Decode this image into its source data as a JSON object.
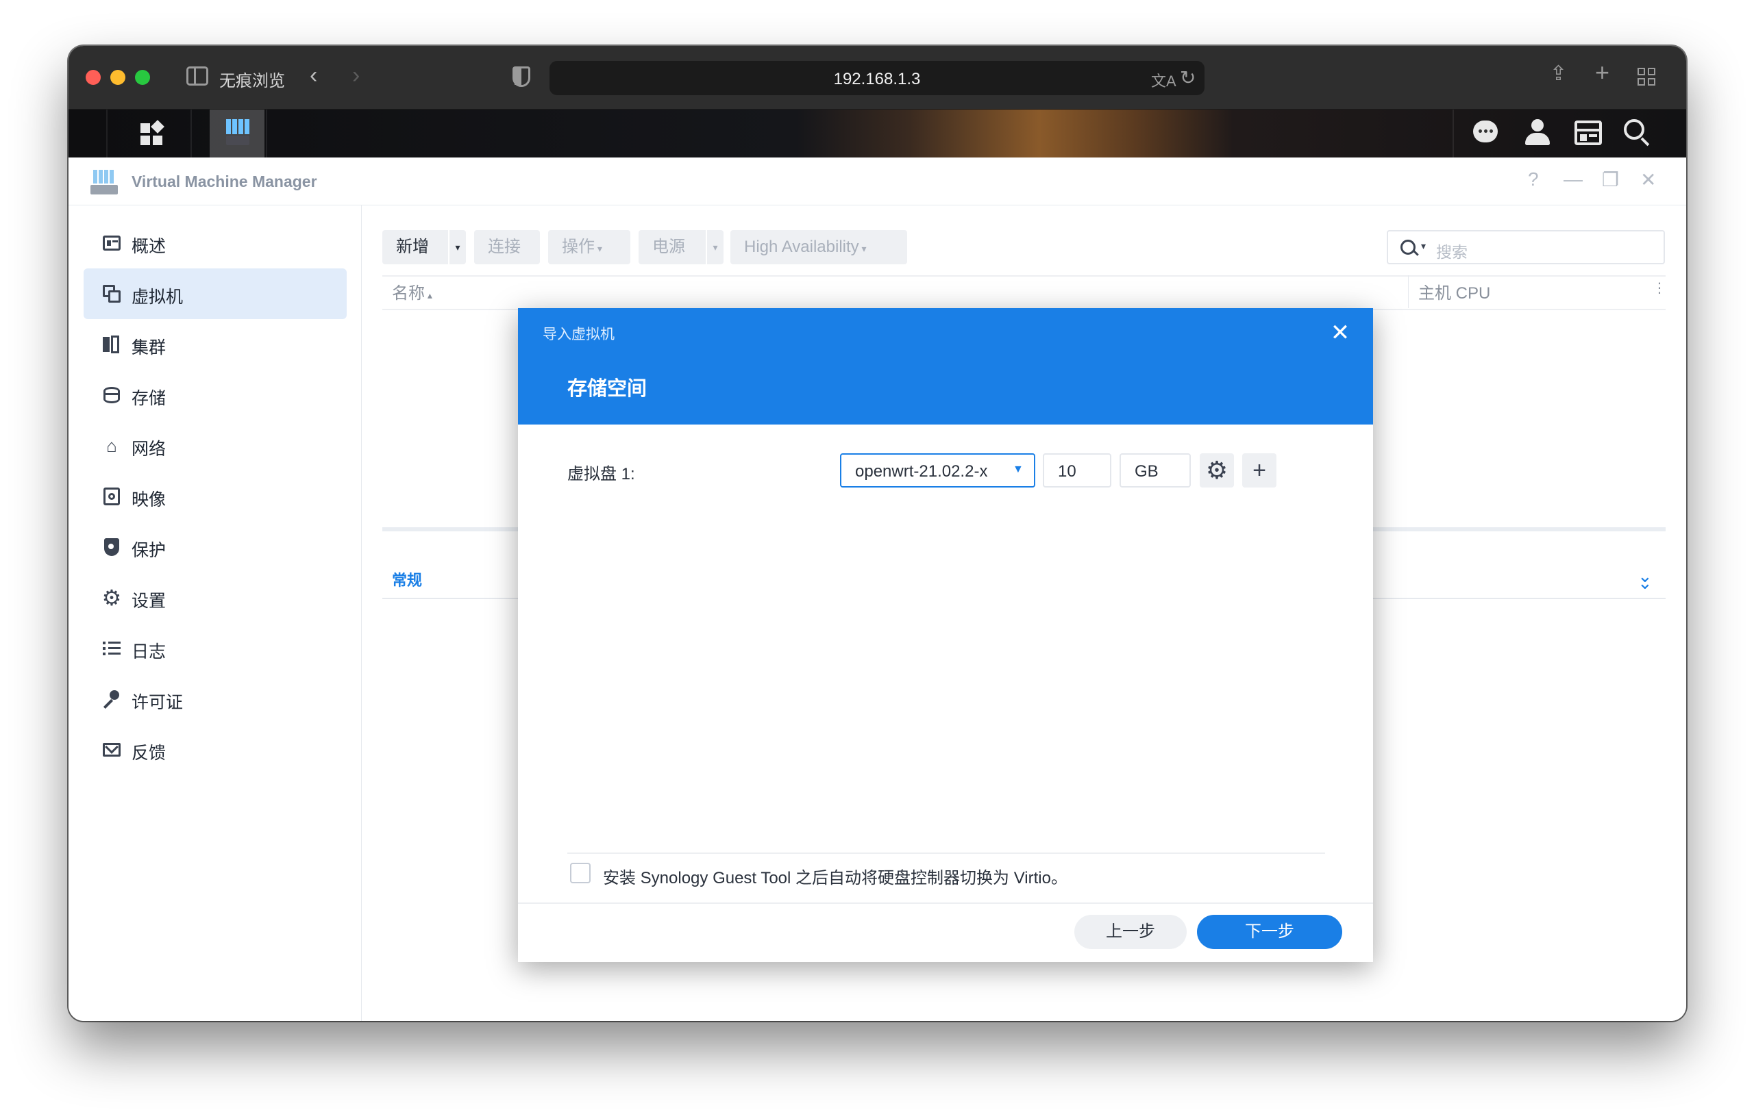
{
  "browser": {
    "tab_label": "无痕浏览",
    "url": "192.168.1.3"
  },
  "app": {
    "title": "Virtual Machine Manager",
    "header_controls": [
      "?",
      "—",
      "❐",
      "✕"
    ]
  },
  "sidebar": {
    "items": [
      {
        "label": "概述",
        "icon": "overview-icon"
      },
      {
        "label": "虚拟机",
        "icon": "virtual-machine-icon",
        "active": true
      },
      {
        "label": "集群",
        "icon": "cluster-icon"
      },
      {
        "label": "存储",
        "icon": "storage-icon"
      },
      {
        "label": "网络",
        "icon": "network-icon"
      },
      {
        "label": "映像",
        "icon": "image-icon"
      },
      {
        "label": "保护",
        "icon": "shield-icon"
      },
      {
        "label": "设置",
        "icon": "gear-icon"
      },
      {
        "label": "日志",
        "icon": "log-icon"
      },
      {
        "label": "许可证",
        "icon": "key-icon"
      },
      {
        "label": "反馈",
        "icon": "mail-icon"
      }
    ]
  },
  "toolbar": {
    "new_label": "新增",
    "connect_label": "连接",
    "action_label": "操作",
    "power_label": "电源",
    "ha_label": "High Availability",
    "search_placeholder": "搜索"
  },
  "table": {
    "col_name": "名称",
    "col_host_cpu": "主机 CPU"
  },
  "detail_tab": "常规",
  "modal": {
    "subtitle": "导入虚拟机",
    "title": "存储空间",
    "vdisk_label": "虚拟盘 1:",
    "vdisk_source": "openwrt-21.02.2-x",
    "size_value": "10",
    "size_unit": "GB",
    "checkbox_label": "安装 Synology Guest Tool 之后自动将硬盘控制器切换为 Virtio。",
    "prev_label": "上一步",
    "next_label": "下一步"
  }
}
